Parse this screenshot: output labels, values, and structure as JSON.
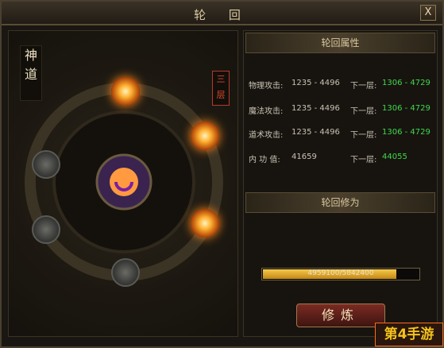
{
  "window": {
    "title": "轮 回",
    "close_label": "X"
  },
  "left": {
    "badge_vertical": "神\n道",
    "layer_label": "三\n层"
  },
  "sections": {
    "attributes": "轮回属性",
    "cultivation": "轮回修为"
  },
  "stats": [
    {
      "label": "物理攻击:",
      "value": "1235 - 4496",
      "next_label": "下一层:",
      "next_value": "1306 - 4729"
    },
    {
      "label": "魔法攻击:",
      "value": "1235 - 4496",
      "next_label": "下一层:",
      "next_value": "1306 - 4729"
    },
    {
      "label": "道术攻击:",
      "value": "1235 - 4496",
      "next_label": "下一层:",
      "next_value": "1306 - 4729"
    },
    {
      "label": "内 功 值:",
      "value": "41659",
      "next_label": "下一层:",
      "next_value": "44055"
    }
  ],
  "progress": {
    "text": "4959100/5842400",
    "fraction": 0.849
  },
  "button": {
    "cultivate": "修炼"
  },
  "watermark": "第4手游"
}
